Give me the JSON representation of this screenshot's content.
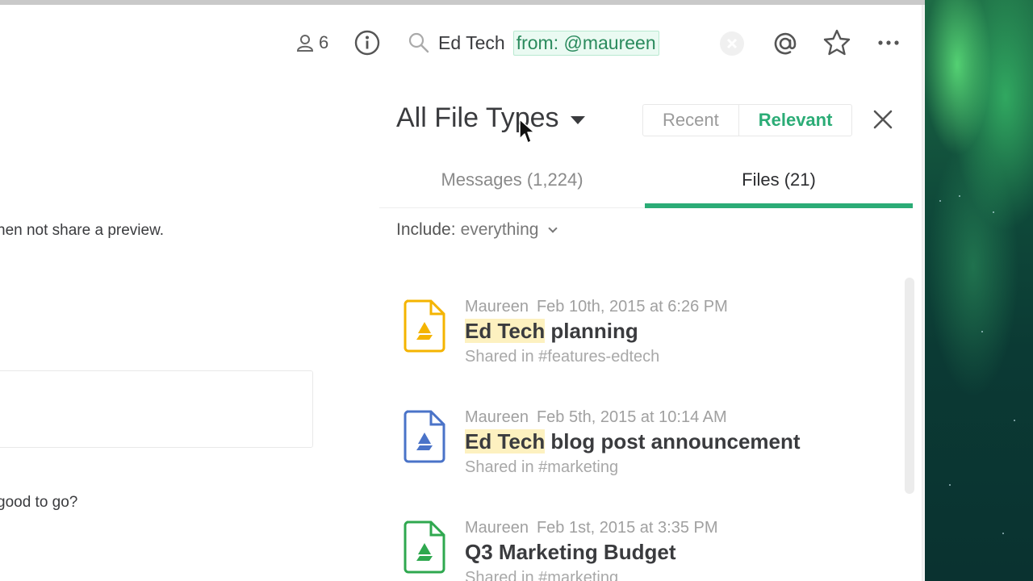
{
  "header": {
    "member_count": "6",
    "search_term": "Ed Tech",
    "search_modifier": "from: @maureen"
  },
  "filters": {
    "file_types_label": "All File Types",
    "sort_options": [
      {
        "label": "Recent",
        "active": false
      },
      {
        "label": "Relevant",
        "active": true
      }
    ],
    "include_label": "Include:",
    "include_value": "everything"
  },
  "tabs": [
    {
      "label": "Messages (1,224)",
      "active": false
    },
    {
      "label": "Files (21)",
      "active": true
    }
  ],
  "results": [
    {
      "author": "Maureen",
      "date": "Feb 10th, 2015 at 6:26 PM",
      "title_highlight": "Ed Tech",
      "title_rest": " planning",
      "shared": "Shared in #features-edtech",
      "icon_color": "#f4b400"
    },
    {
      "author": "Maureen",
      "date": "Feb 5th, 2015 at 10:14 AM",
      "title_highlight": "Ed Tech",
      "title_rest": " blog post announcement",
      "shared": "Shared in #marketing",
      "icon_color": "#4a73c8"
    },
    {
      "author": "Maureen",
      "date": "Feb 1st, 2015 at 3:35 PM",
      "title_highlight": "",
      "title_rest": "Q3 Marketing Budget",
      "shared": "Shared in #marketing",
      "icon_color": "#2fa84f"
    }
  ],
  "left_pane": {
    "line1": "hen not share a preview.",
    "line2": "good to go?"
  },
  "colors": {
    "accent_green": "#2bac76",
    "highlight": "#fdf1c0"
  }
}
